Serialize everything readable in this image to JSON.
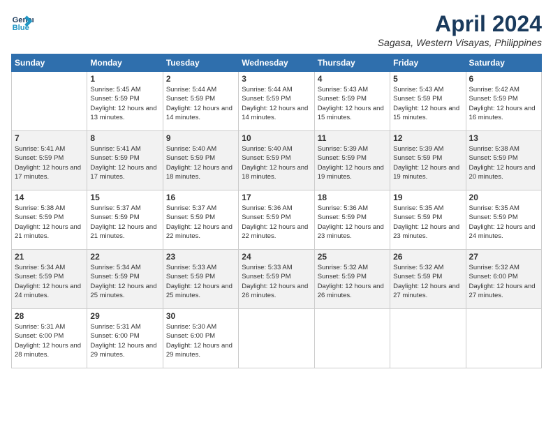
{
  "header": {
    "logo_line1": "General",
    "logo_line2": "Blue",
    "month_year": "April 2024",
    "location": "Sagasa, Western Visayas, Philippines"
  },
  "days_of_week": [
    "Sunday",
    "Monday",
    "Tuesday",
    "Wednesday",
    "Thursday",
    "Friday",
    "Saturday"
  ],
  "weeks": [
    [
      {
        "num": "",
        "info": ""
      },
      {
        "num": "1",
        "info": "Sunrise: 5:45 AM\nSunset: 5:59 PM\nDaylight: 12 hours\nand 13 minutes."
      },
      {
        "num": "2",
        "info": "Sunrise: 5:44 AM\nSunset: 5:59 PM\nDaylight: 12 hours\nand 14 minutes."
      },
      {
        "num": "3",
        "info": "Sunrise: 5:44 AM\nSunset: 5:59 PM\nDaylight: 12 hours\nand 14 minutes."
      },
      {
        "num": "4",
        "info": "Sunrise: 5:43 AM\nSunset: 5:59 PM\nDaylight: 12 hours\nand 15 minutes."
      },
      {
        "num": "5",
        "info": "Sunrise: 5:43 AM\nSunset: 5:59 PM\nDaylight: 12 hours\nand 15 minutes."
      },
      {
        "num": "6",
        "info": "Sunrise: 5:42 AM\nSunset: 5:59 PM\nDaylight: 12 hours\nand 16 minutes."
      }
    ],
    [
      {
        "num": "7",
        "info": "Sunrise: 5:41 AM\nSunset: 5:59 PM\nDaylight: 12 hours\nand 17 minutes."
      },
      {
        "num": "8",
        "info": "Sunrise: 5:41 AM\nSunset: 5:59 PM\nDaylight: 12 hours\nand 17 minutes."
      },
      {
        "num": "9",
        "info": "Sunrise: 5:40 AM\nSunset: 5:59 PM\nDaylight: 12 hours\nand 18 minutes."
      },
      {
        "num": "10",
        "info": "Sunrise: 5:40 AM\nSunset: 5:59 PM\nDaylight: 12 hours\nand 18 minutes."
      },
      {
        "num": "11",
        "info": "Sunrise: 5:39 AM\nSunset: 5:59 PM\nDaylight: 12 hours\nand 19 minutes."
      },
      {
        "num": "12",
        "info": "Sunrise: 5:39 AM\nSunset: 5:59 PM\nDaylight: 12 hours\nand 19 minutes."
      },
      {
        "num": "13",
        "info": "Sunrise: 5:38 AM\nSunset: 5:59 PM\nDaylight: 12 hours\nand 20 minutes."
      }
    ],
    [
      {
        "num": "14",
        "info": "Sunrise: 5:38 AM\nSunset: 5:59 PM\nDaylight: 12 hours\nand 21 minutes."
      },
      {
        "num": "15",
        "info": "Sunrise: 5:37 AM\nSunset: 5:59 PM\nDaylight: 12 hours\nand 21 minutes."
      },
      {
        "num": "16",
        "info": "Sunrise: 5:37 AM\nSunset: 5:59 PM\nDaylight: 12 hours\nand 22 minutes."
      },
      {
        "num": "17",
        "info": "Sunrise: 5:36 AM\nSunset: 5:59 PM\nDaylight: 12 hours\nand 22 minutes."
      },
      {
        "num": "18",
        "info": "Sunrise: 5:36 AM\nSunset: 5:59 PM\nDaylight: 12 hours\nand 23 minutes."
      },
      {
        "num": "19",
        "info": "Sunrise: 5:35 AM\nSunset: 5:59 PM\nDaylight: 12 hours\nand 23 minutes."
      },
      {
        "num": "20",
        "info": "Sunrise: 5:35 AM\nSunset: 5:59 PM\nDaylight: 12 hours\nand 24 minutes."
      }
    ],
    [
      {
        "num": "21",
        "info": "Sunrise: 5:34 AM\nSunset: 5:59 PM\nDaylight: 12 hours\nand 24 minutes."
      },
      {
        "num": "22",
        "info": "Sunrise: 5:34 AM\nSunset: 5:59 PM\nDaylight: 12 hours\nand 25 minutes."
      },
      {
        "num": "23",
        "info": "Sunrise: 5:33 AM\nSunset: 5:59 PM\nDaylight: 12 hours\nand 25 minutes."
      },
      {
        "num": "24",
        "info": "Sunrise: 5:33 AM\nSunset: 5:59 PM\nDaylight: 12 hours\nand 26 minutes."
      },
      {
        "num": "25",
        "info": "Sunrise: 5:32 AM\nSunset: 5:59 PM\nDaylight: 12 hours\nand 26 minutes."
      },
      {
        "num": "26",
        "info": "Sunrise: 5:32 AM\nSunset: 5:59 PM\nDaylight: 12 hours\nand 27 minutes."
      },
      {
        "num": "27",
        "info": "Sunrise: 5:32 AM\nSunset: 6:00 PM\nDaylight: 12 hours\nand 27 minutes."
      }
    ],
    [
      {
        "num": "28",
        "info": "Sunrise: 5:31 AM\nSunset: 6:00 PM\nDaylight: 12 hours\nand 28 minutes."
      },
      {
        "num": "29",
        "info": "Sunrise: 5:31 AM\nSunset: 6:00 PM\nDaylight: 12 hours\nand 29 minutes."
      },
      {
        "num": "30",
        "info": "Sunrise: 5:30 AM\nSunset: 6:00 PM\nDaylight: 12 hours\nand 29 minutes."
      },
      {
        "num": "",
        "info": ""
      },
      {
        "num": "",
        "info": ""
      },
      {
        "num": "",
        "info": ""
      },
      {
        "num": "",
        "info": ""
      }
    ]
  ]
}
